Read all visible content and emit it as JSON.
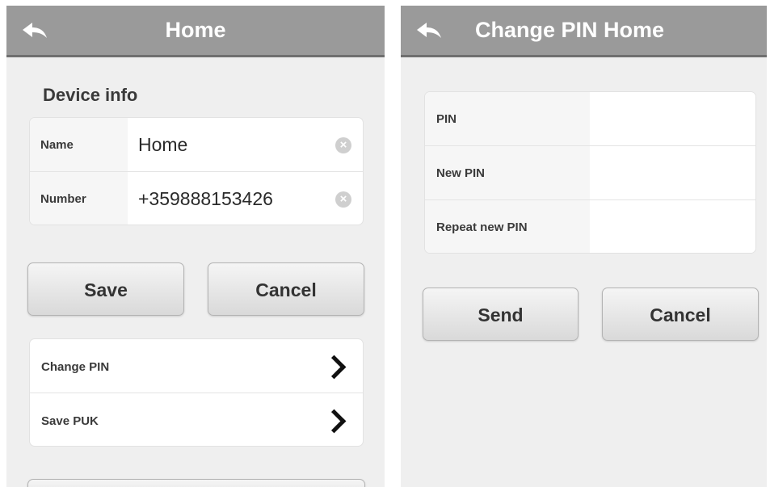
{
  "left": {
    "title": "Home",
    "section_title": "Device info",
    "fields": [
      {
        "label": "Name",
        "value": "Home"
      },
      {
        "label": "Number",
        "value": "+359888153426"
      }
    ],
    "save_label": "Save",
    "cancel_label": "Cancel",
    "menu_items": [
      {
        "label": "Change PIN"
      },
      {
        "label": "Save PUK"
      }
    ]
  },
  "right": {
    "title": "Change PIN Home",
    "fields": [
      {
        "label": "PIN",
        "value": ""
      },
      {
        "label": "New PIN",
        "value": ""
      },
      {
        "label": "Repeat new PIN",
        "value": ""
      }
    ],
    "send_label": "Send",
    "cancel_label": "Cancel"
  },
  "colors": {
    "navbar": "#9a9a9a",
    "background": "#efefef"
  },
  "icons": {
    "back": "back-arrow-icon",
    "clear": "clear-icon",
    "disclosure": "chevron-right-icon"
  }
}
